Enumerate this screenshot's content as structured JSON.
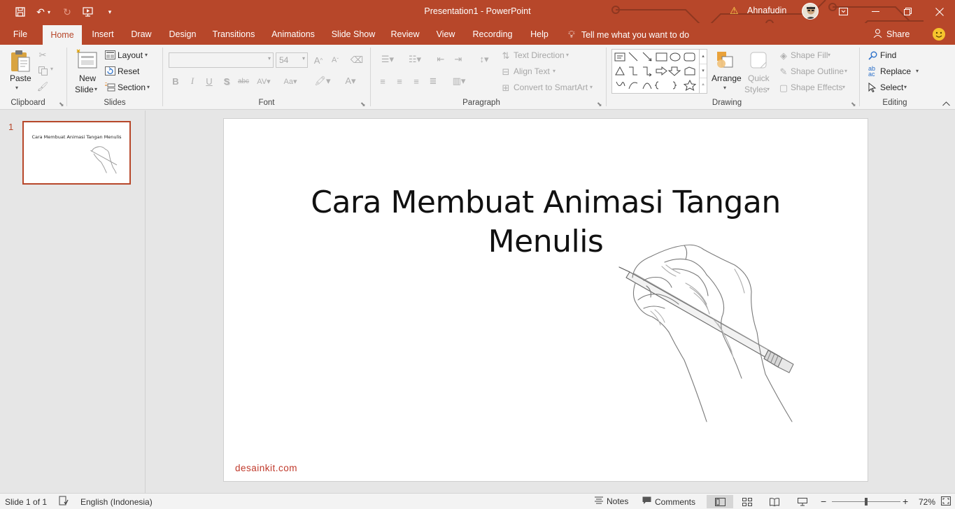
{
  "window": {
    "title": "Presentation1  -  PowerPoint",
    "user": "Ahnafudin"
  },
  "colors": {
    "accent": "#b7472a",
    "ribbon_bg": "#f3f3f3",
    "watermark": "#c0392b"
  },
  "tabs": [
    {
      "label": "File",
      "active": false
    },
    {
      "label": "Home",
      "active": true
    },
    {
      "label": "Insert",
      "active": false
    },
    {
      "label": "Draw",
      "active": false
    },
    {
      "label": "Design",
      "active": false
    },
    {
      "label": "Transitions",
      "active": false
    },
    {
      "label": "Animations",
      "active": false
    },
    {
      "label": "Slide Show",
      "active": false
    },
    {
      "label": "Review",
      "active": false
    },
    {
      "label": "View",
      "active": false
    },
    {
      "label": "Recording",
      "active": false
    },
    {
      "label": "Help",
      "active": false
    }
  ],
  "tellme": "Tell me what you want to do",
  "share": "Share",
  "ribbon": {
    "clipboard": {
      "label": "Clipboard",
      "paste": "Paste"
    },
    "slides": {
      "label": "Slides",
      "new_slide_1": "New",
      "new_slide_2": "Slide",
      "layout": "Layout",
      "reset": "Reset",
      "section": "Section"
    },
    "font": {
      "label": "Font",
      "font_name": "",
      "font_size": "54"
    },
    "paragraph": {
      "label": "Paragraph",
      "text_direction": "Text Direction",
      "align_text": "Align Text",
      "convert_smartart": "Convert to SmartArt"
    },
    "drawing": {
      "label": "Drawing",
      "arrange": "Arrange",
      "quick_1": "Quick",
      "quick_2": "Styles",
      "shape_fill": "Shape Fill",
      "shape_outline": "Shape Outline",
      "shape_effects": "Shape Effects"
    },
    "editing": {
      "label": "Editing",
      "find": "Find",
      "replace": "Replace",
      "select": "Select"
    }
  },
  "thumbnails": [
    {
      "number": "1",
      "title": "Cara Membuat Animasi Tangan Menulis"
    }
  ],
  "slide": {
    "title": "Cara Membuat Animasi Tangan Menulis",
    "watermark": "desainkit.com"
  },
  "status": {
    "slide_info": "Slide 1 of 1",
    "language": "English (Indonesia)",
    "notes": "Notes",
    "comments": "Comments",
    "zoom": "72%",
    "zoom_level": 0.5
  }
}
